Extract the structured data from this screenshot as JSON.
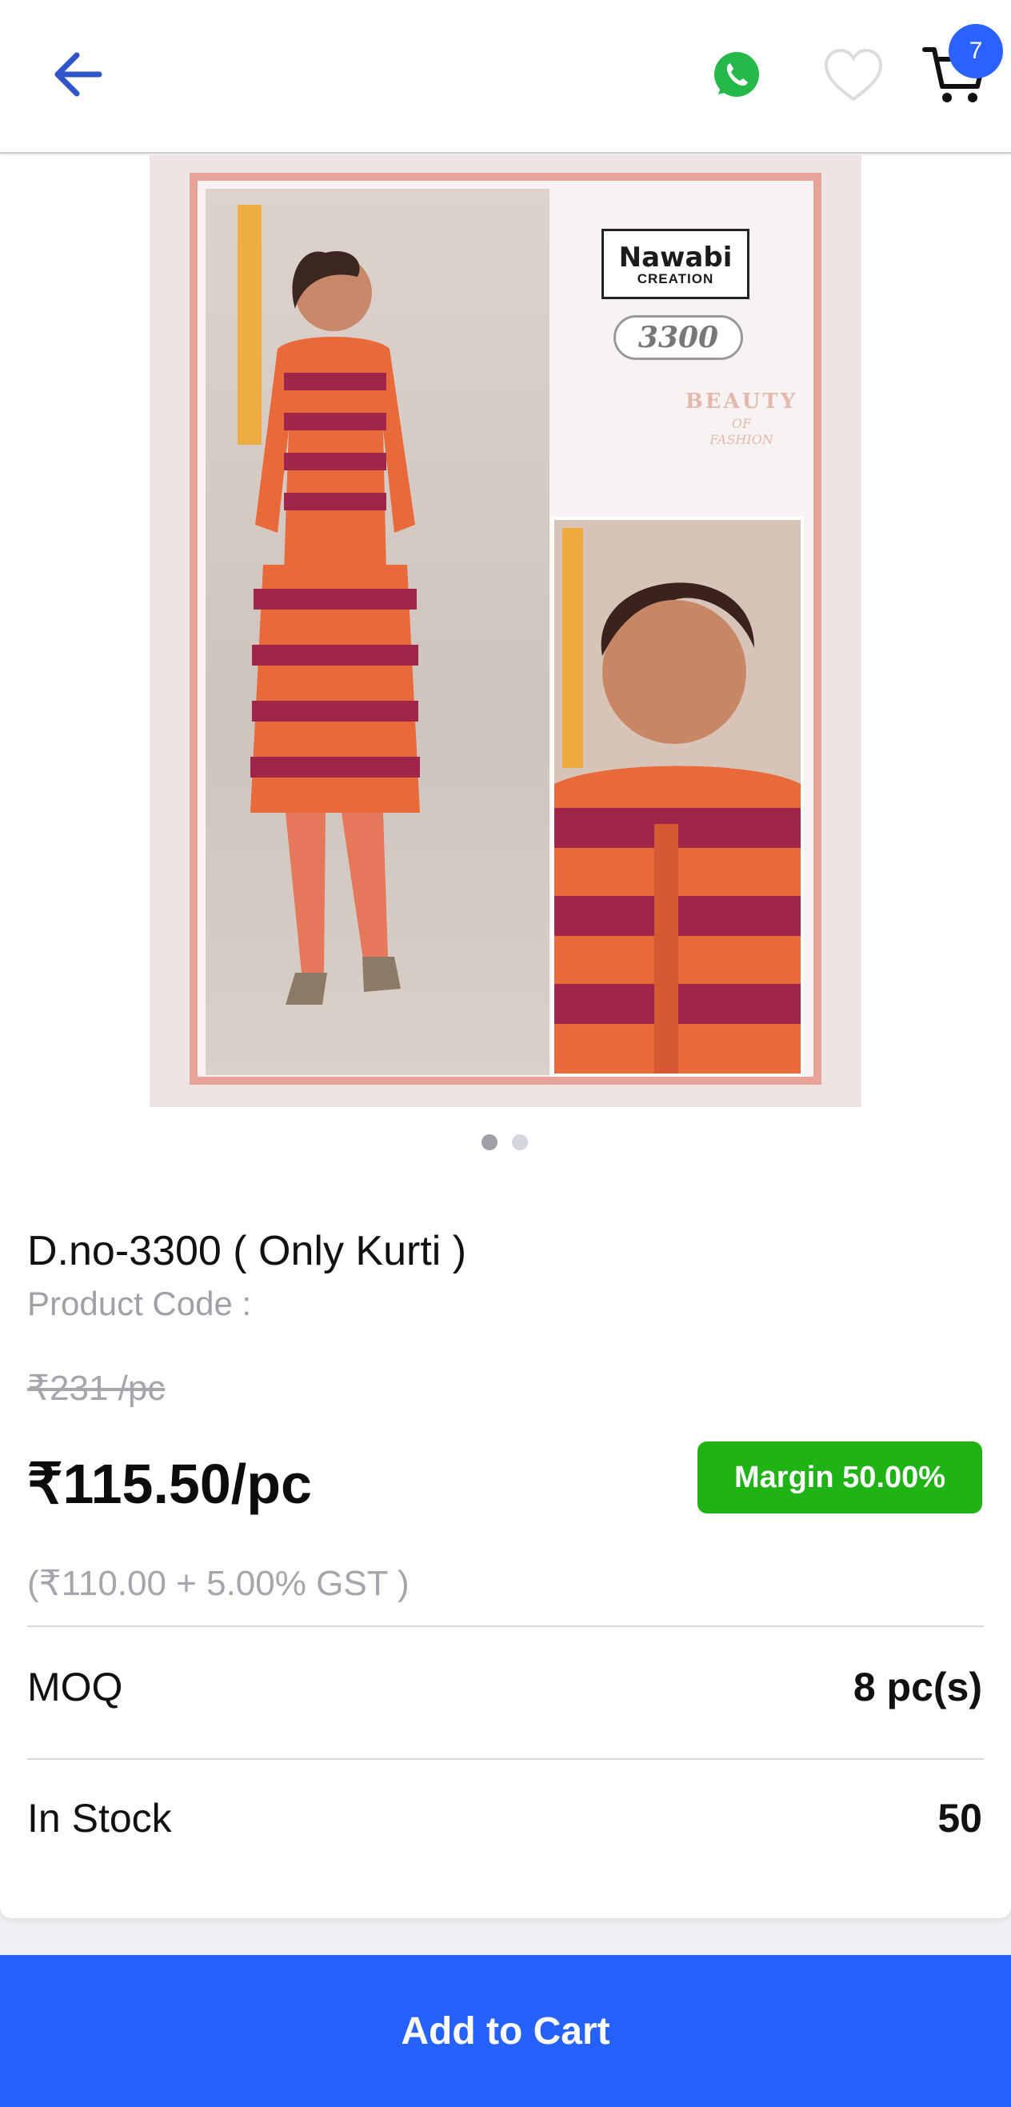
{
  "header": {
    "back_icon": "arrow-left-icon",
    "whatsapp_icon": "whatsapp-icon",
    "wishlist_icon": "heart-icon",
    "cart_icon": "cart-icon",
    "cart_count": "7",
    "accent_color": "#2962ff"
  },
  "gallery": {
    "brand_name": "Nawabi",
    "brand_sub": "CREATION",
    "brand_letter": "N",
    "design_no": "3300",
    "tagline": "BEAUTY",
    "tagline_of": "OF",
    "tagline_fashion": "FASHION",
    "image_count": 2,
    "active_index": 0
  },
  "product": {
    "title": "D.no-3300 ( Only Kurti )",
    "code_label": "Product Code :",
    "mrp": "₹231 /pc",
    "price": "₹115.50/pc",
    "margin": "Margin 50.00%",
    "gst_breakup": "(₹110.00 + 5.00% GST )",
    "margin_color": "#1fb315"
  },
  "details": [
    {
      "label": "MOQ",
      "value": "8 pc(s)"
    },
    {
      "label": "In Stock",
      "value": "50"
    }
  ],
  "footer": {
    "add_to_cart_label": "Add to Cart",
    "button_color": "#2561fb"
  }
}
